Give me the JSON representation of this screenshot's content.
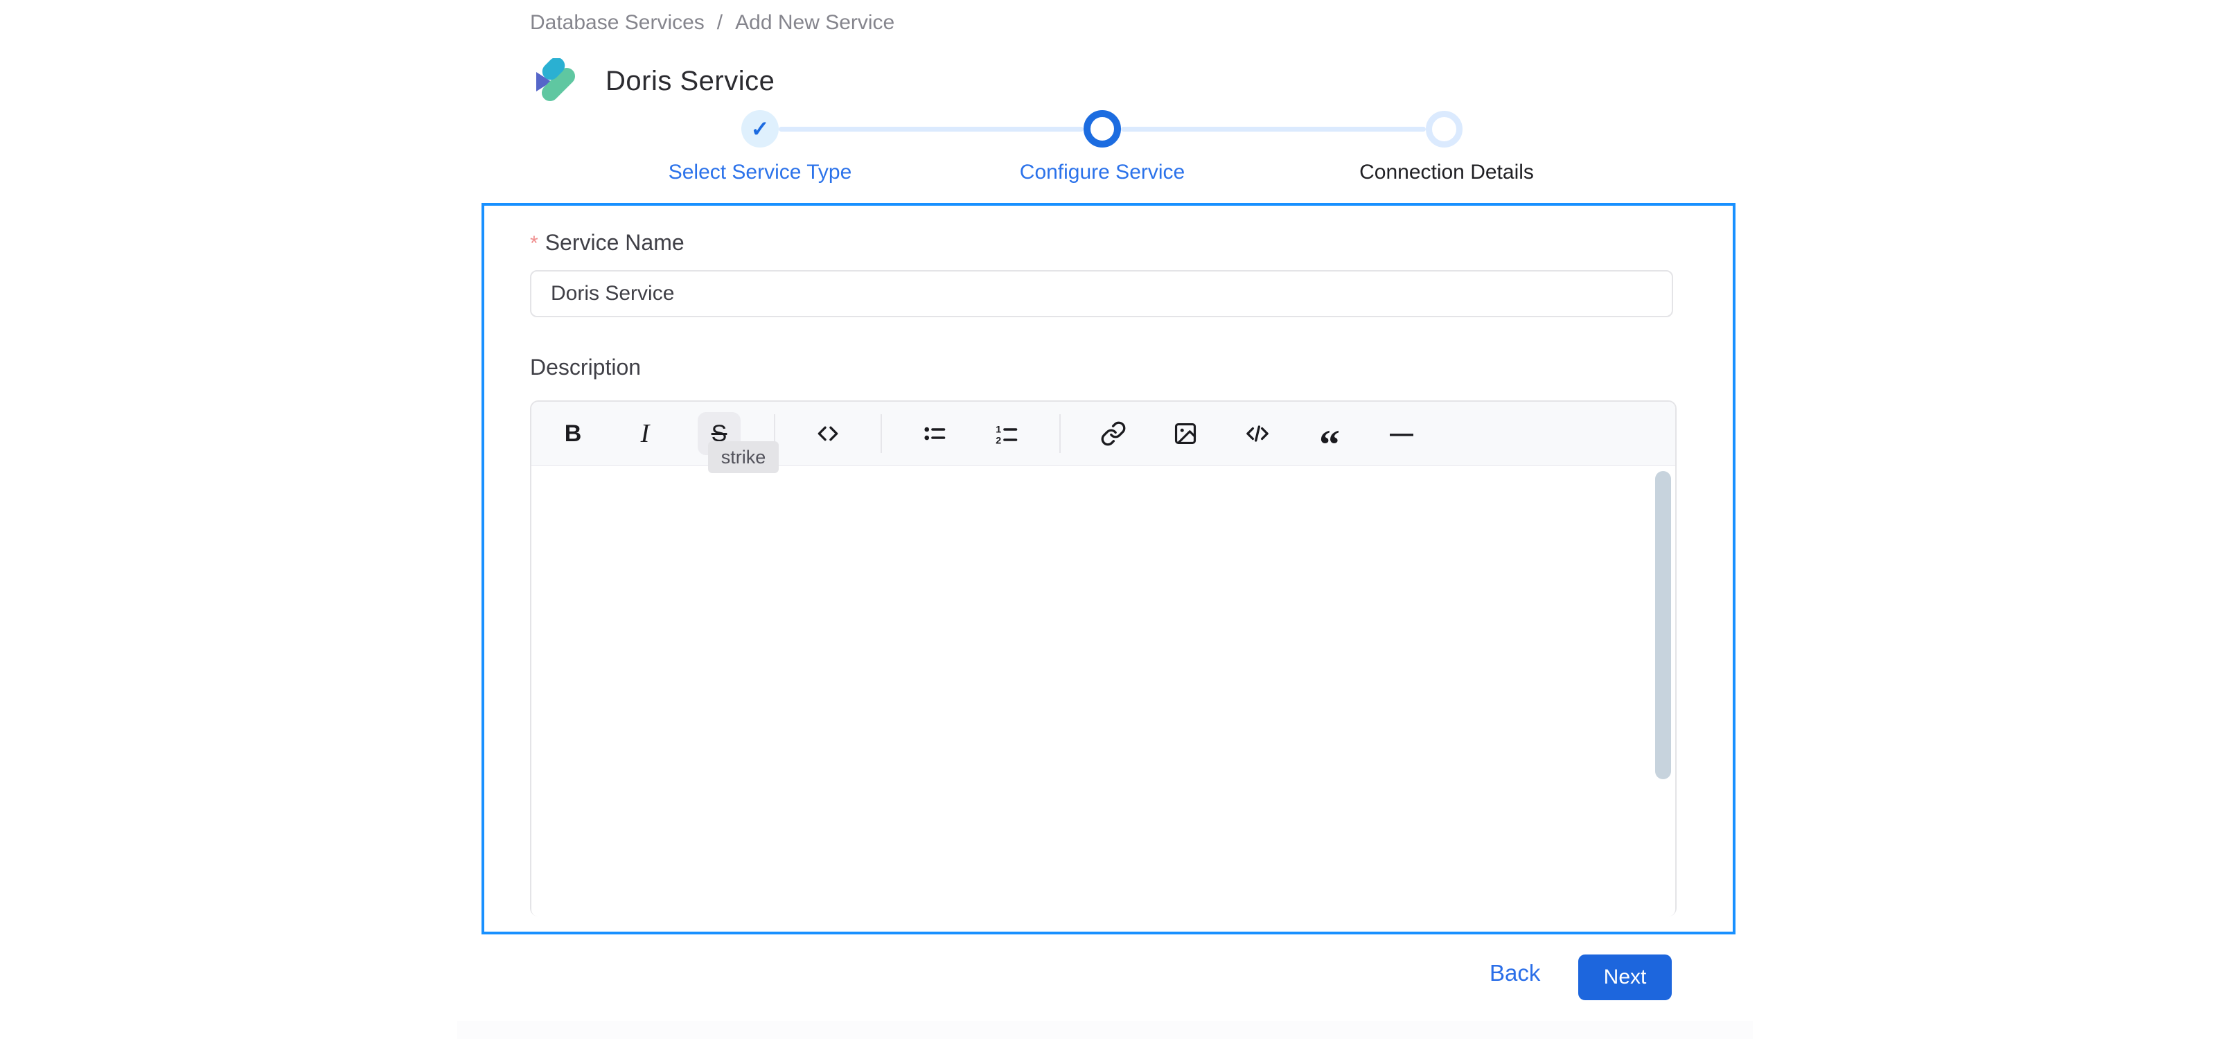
{
  "breadcrumb": {
    "items": [
      "Database Services",
      "Add New Service"
    ],
    "separator": "/"
  },
  "header": {
    "title": "Doris Service",
    "logo": "doris-logo"
  },
  "stepper": {
    "steps": [
      {
        "label": "Select Service Type",
        "state": "completed",
        "icon": "check-icon",
        "check_glyph": "✓"
      },
      {
        "label": "Configure Service",
        "state": "active"
      },
      {
        "label": "Connection Details",
        "state": "upcoming"
      }
    ]
  },
  "form": {
    "service_name": {
      "label": "Service Name",
      "required_marker": "*",
      "value": "Doris Service"
    },
    "description": {
      "label": "Description",
      "value": "",
      "toolbar": {
        "tooltip": "strike",
        "buttons": [
          {
            "name": "bold",
            "glyph": "B"
          },
          {
            "name": "italic",
            "glyph": "I"
          },
          {
            "name": "strike",
            "glyph": "S",
            "state": "hovered"
          },
          {
            "name": "inline-code",
            "glyph": "<>"
          },
          {
            "name": "bullet-list",
            "glyph": ""
          },
          {
            "name": "ordered-list",
            "glyph": ""
          },
          {
            "name": "link",
            "glyph": ""
          },
          {
            "name": "image",
            "glyph": ""
          },
          {
            "name": "code-block",
            "glyph": "</>"
          },
          {
            "name": "blockquote",
            "glyph": "“"
          },
          {
            "name": "horizontal-rule",
            "glyph": "—"
          }
        ]
      }
    }
  },
  "actions": {
    "back": "Back",
    "next": "Next"
  },
  "colors": {
    "panel_border": "#1890ff",
    "accent_blue": "#1c6ce0",
    "link_blue": "#2a6ee8",
    "light_blue": "#dbeafe",
    "done_step_bg": "#dff0fd",
    "toolbar_bg": "#f8f9fb",
    "border_gray": "#e4e4e7",
    "tooltip_bg": "#e4e4e7",
    "scrollbar_thumb": "#c7d3dd",
    "required_star": "#f08f8f",
    "breadcrumb_gray": "#85858d",
    "logo_cyan": "#2ab0d2",
    "logo_purple": "#5566c9",
    "logo_green": "#5fc7a1"
  }
}
